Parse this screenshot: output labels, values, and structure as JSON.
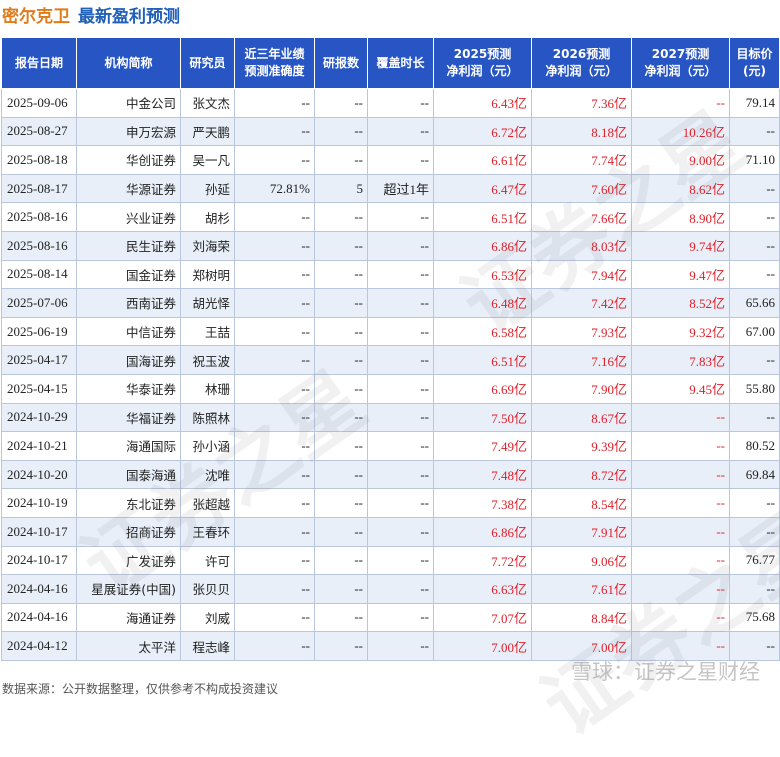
{
  "header": {
    "company": "密尔克卫",
    "subtitle": "最新盈利预测"
  },
  "table": {
    "columns": [
      "报告日期",
      "机构简称",
      "研究员",
      "近三年业绩\n预测准确度",
      "研报数",
      "覆盖时长",
      "2025预测\n净利润（元）",
      "2026预测\n净利润（元）",
      "2027预测\n净利润（元）",
      "目标价\n(元)"
    ],
    "rows": [
      [
        "2025-09-06",
        "中金公司",
        "张文杰",
        "--",
        "--",
        "--",
        "6.43亿",
        "7.36亿",
        "--",
        "79.14"
      ],
      [
        "2025-08-27",
        "申万宏源",
        "严天鹏",
        "--",
        "--",
        "--",
        "6.72亿",
        "8.18亿",
        "10.26亿",
        "--"
      ],
      [
        "2025-08-18",
        "华创证券",
        "吴一凡",
        "--",
        "--",
        "--",
        "6.61亿",
        "7.74亿",
        "9.00亿",
        "71.10"
      ],
      [
        "2025-08-17",
        "华源证券",
        "孙延",
        "72.81%",
        "5",
        "超过1年",
        "6.47亿",
        "7.60亿",
        "8.62亿",
        "--"
      ],
      [
        "2025-08-16",
        "兴业证券",
        "胡杉",
        "--",
        "--",
        "--",
        "6.51亿",
        "7.66亿",
        "8.90亿",
        "--"
      ],
      [
        "2025-08-16",
        "民生证券",
        "刘海荣",
        "--",
        "--",
        "--",
        "6.86亿",
        "8.03亿",
        "9.74亿",
        "--"
      ],
      [
        "2025-08-14",
        "国金证券",
        "郑树明",
        "--",
        "--",
        "--",
        "6.53亿",
        "7.94亿",
        "9.47亿",
        "--"
      ],
      [
        "2025-07-06",
        "西南证券",
        "胡光怿",
        "--",
        "--",
        "--",
        "6.48亿",
        "7.42亿",
        "8.52亿",
        "65.66"
      ],
      [
        "2025-06-19",
        "中信证券",
        "王喆",
        "--",
        "--",
        "--",
        "6.58亿",
        "7.93亿",
        "9.32亿",
        "67.00"
      ],
      [
        "2025-04-17",
        "国海证券",
        "祝玉波",
        "--",
        "--",
        "--",
        "6.51亿",
        "7.16亿",
        "7.83亿",
        "--"
      ],
      [
        "2025-04-15",
        "华泰证券",
        "林珊",
        "--",
        "--",
        "--",
        "6.69亿",
        "7.90亿",
        "9.45亿",
        "55.80"
      ],
      [
        "2024-10-29",
        "华福证券",
        "陈照林",
        "--",
        "--",
        "--",
        "7.50亿",
        "8.67亿",
        "--",
        "--"
      ],
      [
        "2024-10-21",
        "海通国际",
        "孙小涵",
        "--",
        "--",
        "--",
        "7.49亿",
        "9.39亿",
        "--",
        "80.52"
      ],
      [
        "2024-10-20",
        "国泰海通",
        "沈唯",
        "--",
        "--",
        "--",
        "7.48亿",
        "8.72亿",
        "--",
        "69.84"
      ],
      [
        "2024-10-19",
        "东北证券",
        "张超越",
        "--",
        "--",
        "--",
        "7.38亿",
        "8.54亿",
        "--",
        "--"
      ],
      [
        "2024-10-17",
        "招商证券",
        "王春环",
        "--",
        "--",
        "--",
        "6.86亿",
        "7.91亿",
        "--",
        "--"
      ],
      [
        "2024-10-17",
        "广发证券",
        "许可",
        "--",
        "--",
        "--",
        "7.72亿",
        "9.06亿",
        "--",
        "76.77"
      ],
      [
        "2024-04-16",
        "星展证券(中国)",
        "张贝贝",
        "--",
        "--",
        "--",
        "6.63亿",
        "7.61亿",
        "--",
        "--"
      ],
      [
        "2024-04-16",
        "海通证券",
        "刘威",
        "--",
        "--",
        "--",
        "7.07亿",
        "8.84亿",
        "--",
        "75.68"
      ],
      [
        "2024-04-12",
        "太平洋",
        "程志峰",
        "--",
        "--",
        "--",
        "7.00亿",
        "7.00亿",
        "--",
        "--"
      ]
    ]
  },
  "footer": "数据来源：公开数据整理，仅供参考不构成投资建议",
  "watermark": {
    "text": "证券之星",
    "logo": "雪球：证券之星财经"
  },
  "colors": {
    "header_bg": "#2756c4",
    "profit_red": "#e0202a",
    "company_orange": "#e07b1a",
    "title_blue": "#1f5fb8",
    "alt_row": "#e8eff9"
  }
}
